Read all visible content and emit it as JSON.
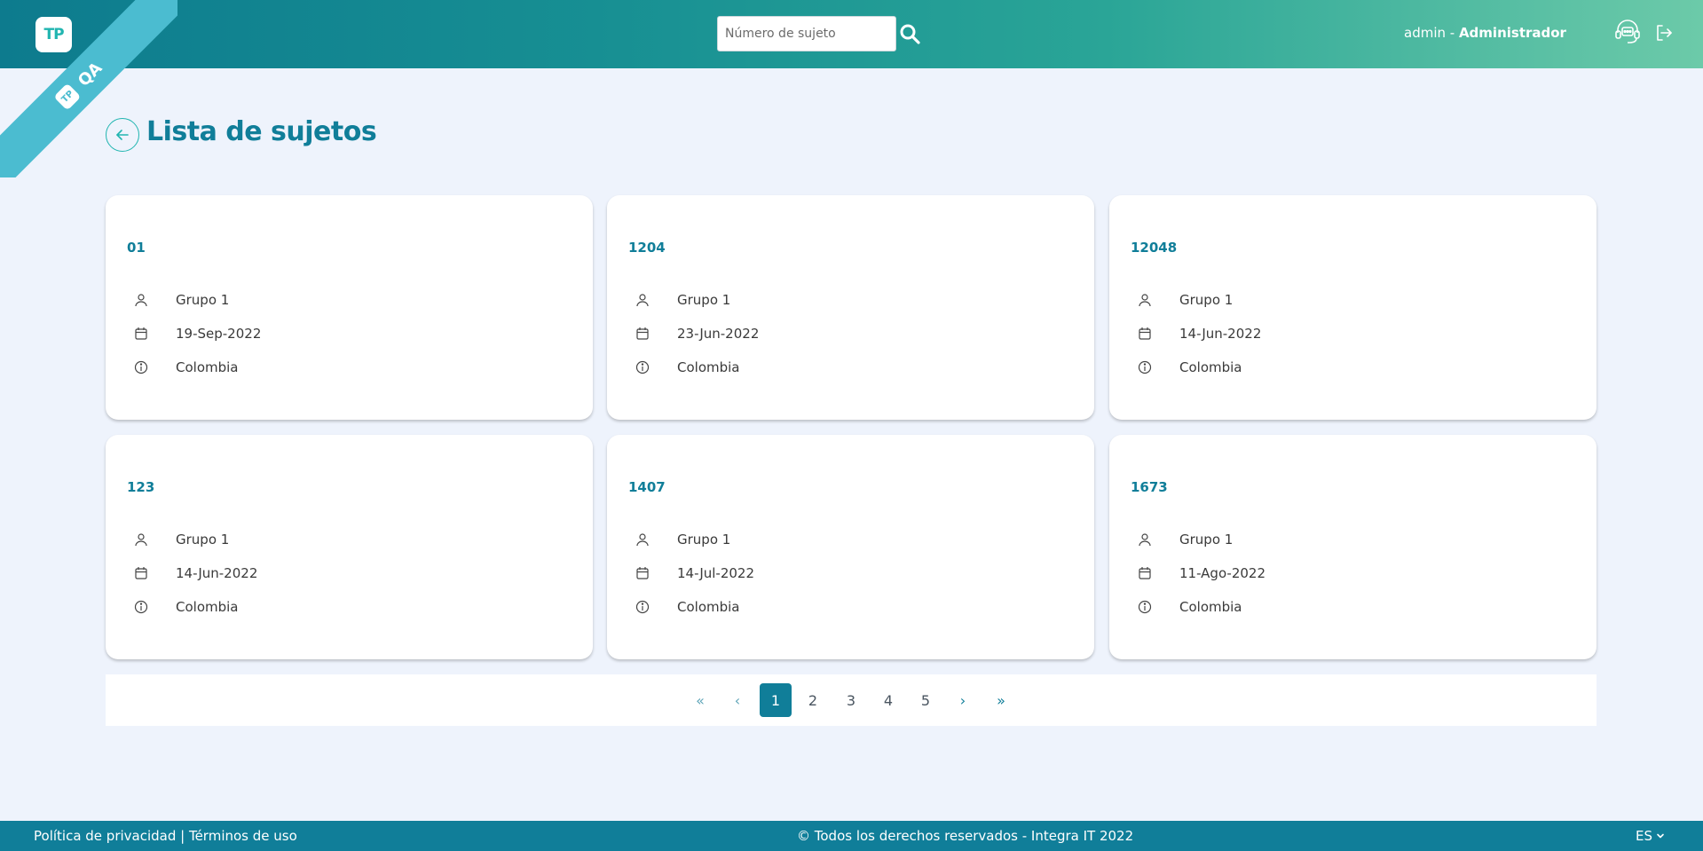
{
  "header": {
    "logo_text": "TP",
    "env_badge": "QA",
    "search_placeholder": "Número de sujeto",
    "user_name": "admin",
    "user_separator": " - ",
    "user_role": "Administrador"
  },
  "page": {
    "title": "Lista de sujetos"
  },
  "cards": [
    {
      "id": "01",
      "group": "Grupo 1",
      "date": "19-Sep-2022",
      "country": "Colombia"
    },
    {
      "id": "1204",
      "group": "Grupo 1",
      "date": "23-Jun-2022",
      "country": "Colombia"
    },
    {
      "id": "12048",
      "group": "Grupo 1",
      "date": "14-Jun-2022",
      "country": "Colombia"
    },
    {
      "id": "123",
      "group": "Grupo 1",
      "date": "14-Jun-2022",
      "country": "Colombia"
    },
    {
      "id": "1407",
      "group": "Grupo 1",
      "date": "14-Jul-2022",
      "country": "Colombia"
    },
    {
      "id": "1673",
      "group": "Grupo 1",
      "date": "11-Ago-2022",
      "country": "Colombia"
    }
  ],
  "pagination": {
    "first": "«",
    "prev": "‹",
    "pages": [
      "1",
      "2",
      "3",
      "4",
      "5"
    ],
    "current": "1",
    "next": "›",
    "last": "»"
  },
  "footer": {
    "privacy": "Política de privacidad",
    "separator": " | ",
    "terms": "Términos de uso",
    "copyright": "© Todos los derechos reservados - Integra IT 2022",
    "language": "ES"
  },
  "colors": {
    "primary": "#107e99",
    "accent": "#21b5b0",
    "ribbon": "#4bbcd0",
    "background": "#eef3fc"
  }
}
